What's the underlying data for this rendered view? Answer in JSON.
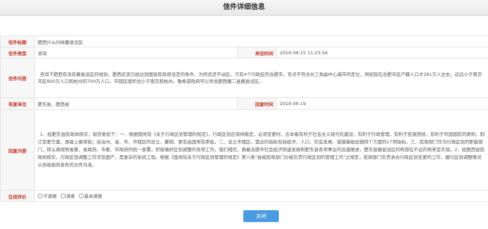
{
  "page": {
    "title": "信件详细信息"
  },
  "letter": {
    "subject_label": "信件标题",
    "subject": "肥西什么时候撤县设区",
    "type_label": "信件类型",
    "type": "咨询",
    "time_label": "来信时间",
    "time": "2019-08-15 11:23:56",
    "content_label": "信件内容",
    "content": "咨询下肥西有没有撤县设区的规划，肥西应该已经达到国家民政部设定的条件，为何迟迟不动区，只有4个行政区的合肥市，有点不符合长三角副中心城市的定位，例如现在合肥市区户籍人口才281万人左右，远远小于南京市区800万人口和杭州的700万人口，市辖区面积也小于南京和杭州。敬希望政府可以考虑肥西撤二县撤县设区。"
  },
  "reply": {
    "unit_label": "答复单位",
    "unit": "肥东县、肥西县",
    "time_label": "回复时间",
    "time": "2019-08-19",
    "content_label": "回复内容",
    "content": "1、经肥东县民政局核实，现答复如下：一、根据国务院《关于行政区划管理的规定》，行政区划应保持稳定，必须变更时，应本着有利于社会主义现代化建设，有利于行政管理，有利于民族团结，有利于巩固国防的原则，制订变更方案，逐级上报审批；自治州、县、市、市辖区的设立、撤销、更名由国务院审批。二、设立市辖区，需达的指标包括经济、人口、社会发展、城镇基础设施四个方面的17项指标。三、民政部门作为行政区划的职能部门，将认真按照省委、省政府、市委、市政府的统一部署，积极做好区划调整的各项工作。我们相信，随着合肥市社会经济快速发展和肥东县各项事业的迅速推进，肥东县撤县设区的构想在不远的将来会实现。2、经肥西县民政局核实，行政区划调整工作涉及国产，是复杂的系统工程。根据《国务院关于行政区划管理的规定》第八条\"县级民政部门分级负责行政区划的管理工作\"之规定，民政部门负责承办行政区划变更的工作，履行区划调整情况以各级政府发布的文件为准。"
  },
  "rating": {
    "label": "在线评价",
    "options": [
      "不满意",
      "满意",
      "基本满意"
    ]
  },
  "buttons": {
    "close": "关闭"
  }
}
